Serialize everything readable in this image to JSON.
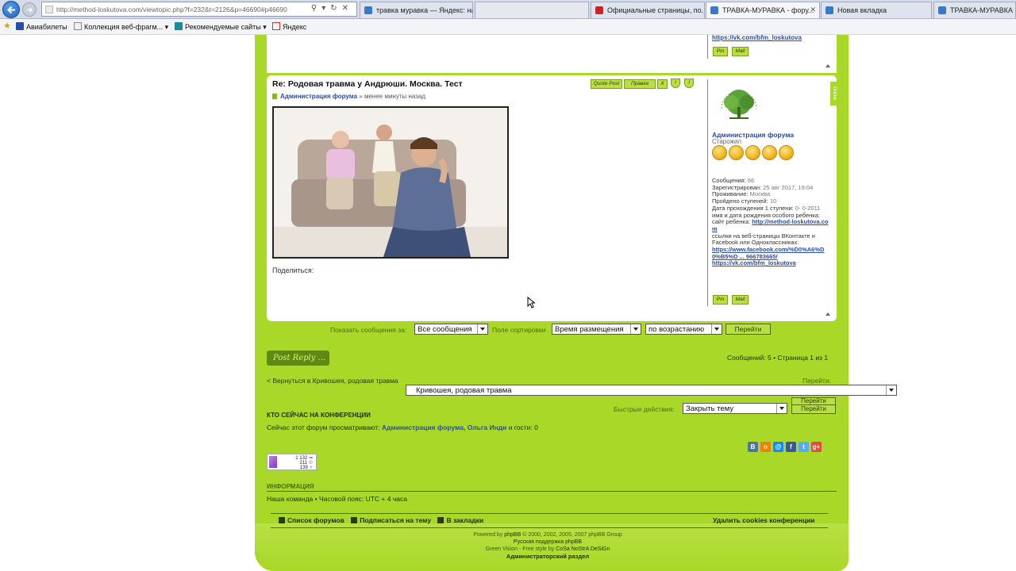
{
  "browser": {
    "address_url": "http://method-loskutova.com/viewtopic.php?f=232&t=2126&p=46690#p46690",
    "tabs": [
      {
        "label": "травка муравка — Яндекс: на...",
        "color": "#3b78c5"
      },
      {
        "label": "",
        "color": "#d6dbe9"
      },
      {
        "label": "Официальные страницы, по...",
        "color": "#d02020"
      },
      {
        "label": "ТРАВКА-МУРАВКА - фору...",
        "color": "#3b78c5"
      },
      {
        "label": "Новая вкладка",
        "color": "#3b78c5"
      },
      {
        "label": "ТРАВКА-МУРАВКА -",
        "color": "#3b78c5"
      }
    ],
    "favorites": [
      {
        "label": "Авиабилеты",
        "icon": "plane-icon"
      },
      {
        "label": "Коллекция веб-фрагм... ▾",
        "icon": "webslice-icon"
      },
      {
        "label": "Рекомендуемые сайты ▾",
        "icon": "bing-icon"
      },
      {
        "label": "Яндекс",
        "icon": "yandex-icon"
      }
    ]
  },
  "prev_post": {
    "vk_link": "https://vk.com/bfm_loskutova",
    "pm_label": "Pm",
    "mail_label": "Mail"
  },
  "post": {
    "title": "Re: Родовая травма у Андрюши. Москва. Тест",
    "author": "Администрация форума",
    "time": "» менее минуты назад",
    "share_label": "Поделиться:",
    "buttons": {
      "quote": "Quote Post",
      "edit": "Правка",
      "delete": "X",
      "warn": "!",
      "report": "!"
    },
    "online_label": "Online"
  },
  "profile": {
    "name": "Администрация форума",
    "rank": "Старожил",
    "medals_count": 5,
    "messages_label": "Сообщения:",
    "messages": "66",
    "registered_label": "Зарегистрирован:",
    "registered": "25 авг 2017, 19:04",
    "location_label": "Проживание:",
    "location": "Москва",
    "steps_label": "Пройдено ступеней:",
    "steps": "10",
    "step1_date_label": "Дата прохождения 1 ступени:",
    "step1_date": "0- 0-2011",
    "child_label": "имя и дата рождения особого ребенка:",
    "child_site_label": "сайт ребенка:",
    "child_site": "http://method-loskutova.com",
    "links_label": "ссылки на веб-страницы ВКонтакте и Facebook или Одноклассниках:",
    "fb_link": "https://www.facebook.com/%D0%A6%D0%B5%D ... 966783665/",
    "vk_link": "https://vk.com/bfm_loskutova",
    "pm_label": "Pm",
    "mail_label": "Mail"
  },
  "sortbar": {
    "show_label": "Показать сообщения за:",
    "show_value": "Все сообщения",
    "sort_label": "Поле сортировки",
    "sort_value": "Время размещения",
    "order_value": "по возрастанию",
    "go_label": "Перейти"
  },
  "actions": {
    "post_reply": "Post Reply ...",
    "pagination": "Сообщений: 5 • Страница 1 из 1",
    "back_link": "< Вернуться в Кривошея, родовая травма",
    "jump_label": "Перейти:",
    "jump_value": "Кривошея, родовая травма",
    "jump_go": "Перейти",
    "quick_label": "Быстрые действия:",
    "quick_value": "Закрыть тему",
    "quick_go": "Перейти"
  },
  "who": {
    "heading": "КТО СЕЙЧАС НА КОНФЕРЕНЦИИ",
    "prefix": "Сейчас этот форум просматривают:",
    "users": "Администрация форума, Ольга Инди",
    "suffix": "и гости: 0"
  },
  "counter": {
    "line1": "1 132 ⇒",
    "line2": "211 ☉",
    "line3": "139 ♀"
  },
  "info": {
    "heading": "ИНФОРМАЦИЯ",
    "text": "Наша команда • Часовой пояс: UTC + 4 часа"
  },
  "footer": {
    "forum_list": "Список форумов",
    "subscribe": "Подписаться на тему",
    "bookmarks": "В закладки",
    "delete_cookies": "Удалить cookies конференции",
    "powered": "Powered by",
    "phpbb": "phpBB",
    "copyright": "© 2000, 2002, 2005, 2007 phpBB Group",
    "support": "Русская поддержка phpBB",
    "style": "Green Vision - Free style by",
    "style_author": "CoSa NoStrA DeSiGn",
    "admin": "Администраторский раздел"
  },
  "colors": {
    "page_green": "#a9d829",
    "link_blue": "#2a4da8",
    "dark_green": "#4d6e08"
  }
}
